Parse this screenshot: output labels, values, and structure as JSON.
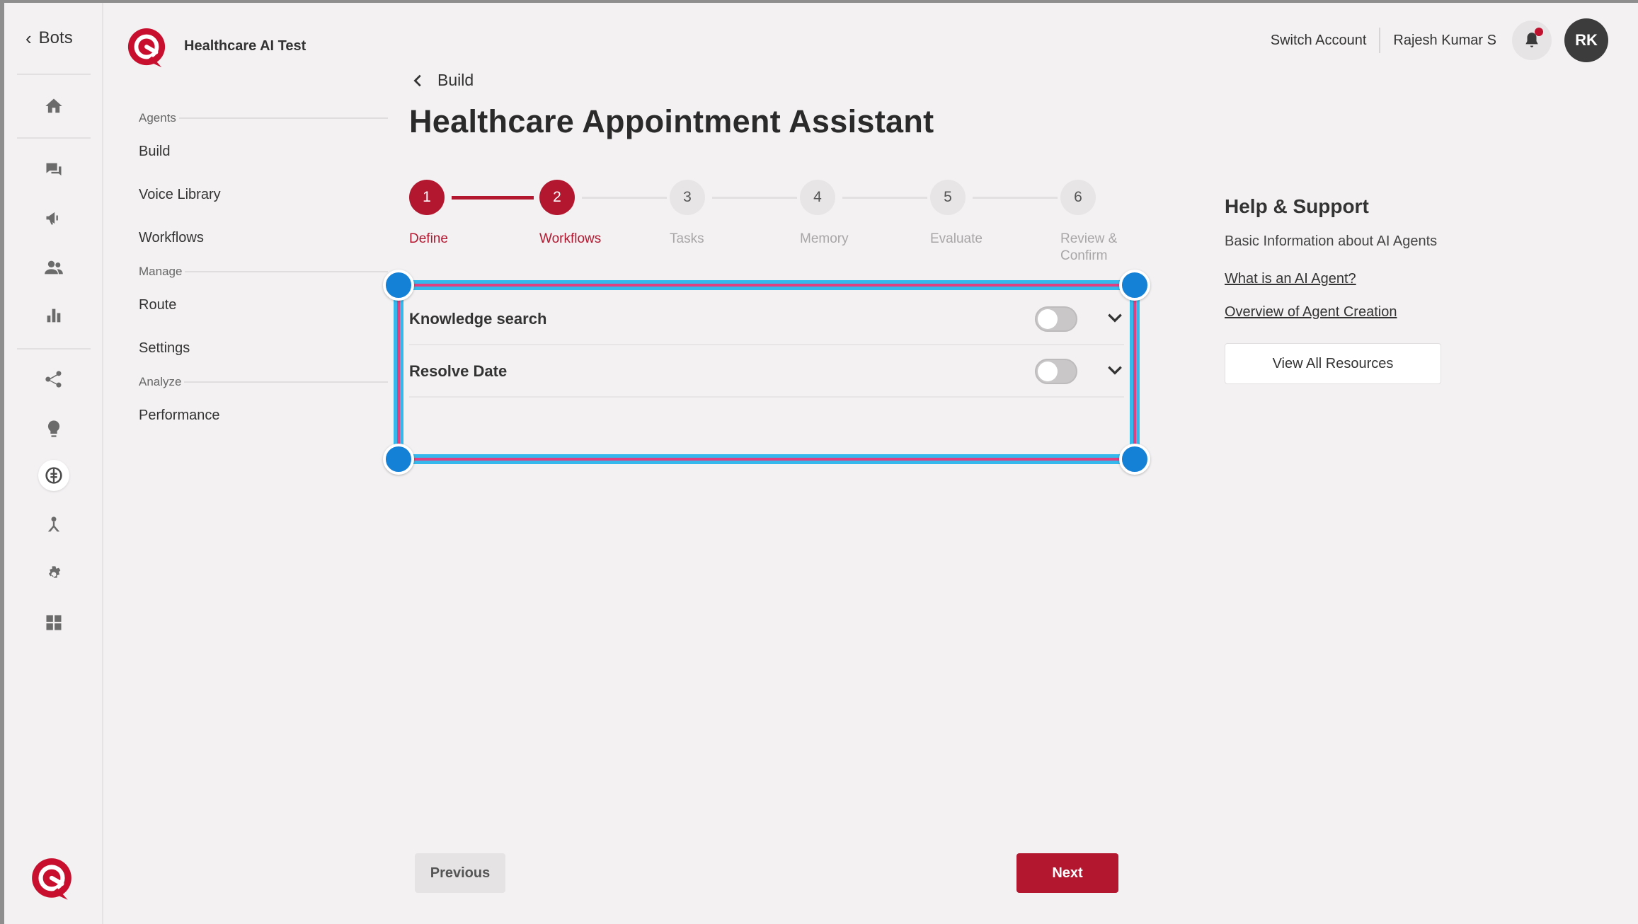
{
  "rail": {
    "back_label": "Bots",
    "icons": [
      "home-icon",
      "chat-icon",
      "megaphone-icon",
      "users-icon",
      "bar-chart-icon",
      "share-icon",
      "lightbulb-icon",
      "ai-brain-icon",
      "hierarchy-icon",
      "gear-icon",
      "apps-icon"
    ]
  },
  "header": {
    "workspace": "Healthcare AI Test",
    "switch_account": "Switch Account",
    "user_name": "Rajesh Kumar S",
    "avatar_initials": "RK"
  },
  "subnav": {
    "groups": [
      {
        "label": "Agents",
        "items": [
          "Build",
          "Voice Library",
          "Workflows"
        ]
      },
      {
        "label": "Manage",
        "items": [
          "Route",
          "Settings"
        ]
      },
      {
        "label": "Analyze",
        "items": [
          "Performance"
        ]
      }
    ]
  },
  "main": {
    "breadcrumb": "Build",
    "title": "Healthcare Appointment Assistant",
    "steps": [
      {
        "num": "1",
        "label": "Define",
        "active": true
      },
      {
        "num": "2",
        "label": "Workflows",
        "active": true
      },
      {
        "num": "3",
        "label": "Tasks",
        "active": false
      },
      {
        "num": "4",
        "label": "Memory",
        "active": false
      },
      {
        "num": "5",
        "label": "Evaluate",
        "active": false
      },
      {
        "num": "6",
        "label": "Review & Confirm",
        "active": false
      }
    ],
    "workflows": [
      {
        "name": "Knowledge search",
        "enabled": false
      },
      {
        "name": "Resolve Date",
        "enabled": false
      }
    ],
    "previous": "Previous",
    "next": "Next"
  },
  "help": {
    "title": "Help & Support",
    "subtitle": "Basic Information about AI Agents",
    "links": [
      "What is an AI Agent?",
      "Overview of Agent Creation"
    ],
    "button": "View All Resources"
  },
  "colors": {
    "accent": "#b3172f",
    "selection_outline": "#35b9ec",
    "selection_inner": "#e0407f",
    "handle": "#1480d6"
  }
}
